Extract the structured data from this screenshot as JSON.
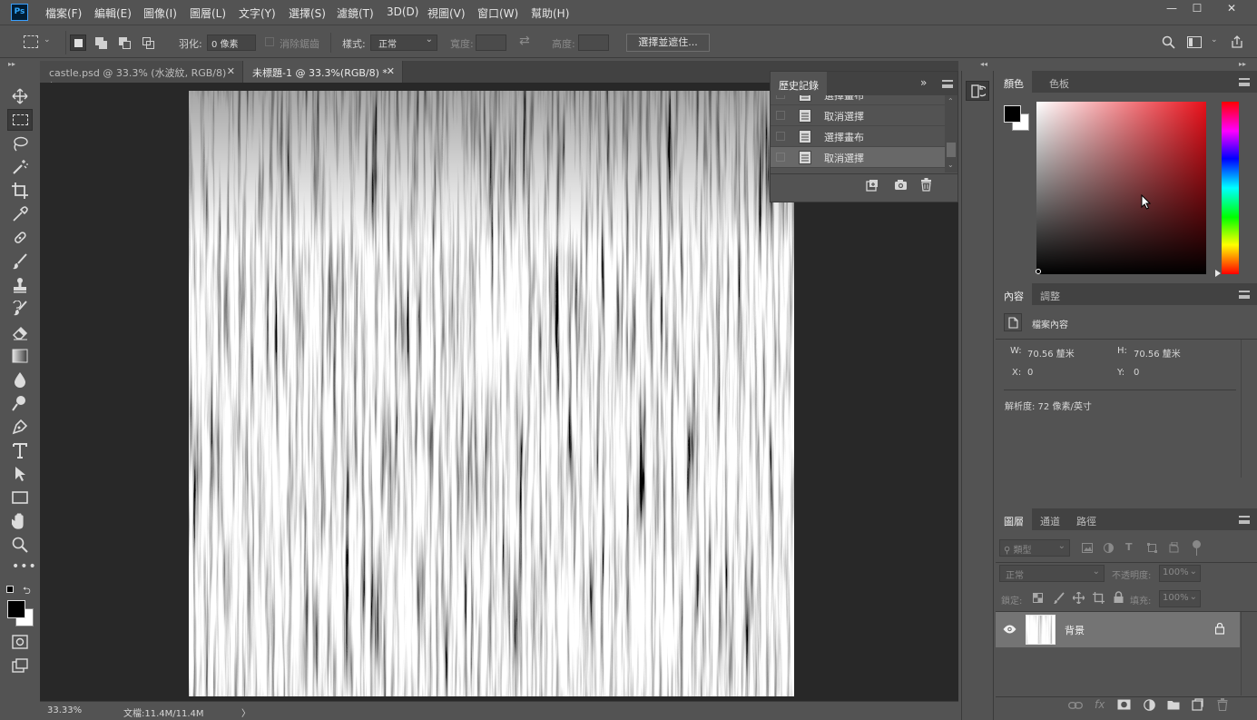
{
  "app": {
    "logo_text": "Ps"
  },
  "menu": [
    "檔案(F)",
    "編輯(E)",
    "圖像(I)",
    "圖層(L)",
    "文字(Y)",
    "選擇(S)",
    "濾鏡(T)",
    "3D(D)",
    "視圖(V)",
    "窗口(W)",
    "幫助(H)"
  ],
  "window_controls": {
    "minimize": "—",
    "maximize": "☐",
    "close": "✕"
  },
  "options": {
    "feather_label": "羽化:",
    "feather_value": "0 像素",
    "antialias_label": "消除鋸齒",
    "style_label": "樣式:",
    "style_value": "正常",
    "width_label": "寬度:",
    "height_label": "高度:",
    "select_mask_button": "選擇並遮住..."
  },
  "tabs": [
    {
      "label": "castle.psd @ 33.3% (水波紋, RGB/8) *",
      "close": "✕"
    },
    {
      "label": "未標題-1 @ 33.3%(RGB/8) *",
      "close": "✕"
    }
  ],
  "status": {
    "zoom": "33.33%",
    "doc_info": "文檔:11.4M/11.4M",
    "arrow": "〉"
  },
  "history": {
    "title": "歷史記錄",
    "items": [
      "選擇畫布",
      "取消選擇",
      "選擇畫布",
      "取消選擇"
    ],
    "selected_index": 3
  },
  "color_panel": {
    "tabs": [
      "顏色",
      "色板"
    ],
    "foreground": "#000000",
    "background": "#ffffff",
    "hue_color": "#e8101a"
  },
  "properties_panel": {
    "tabs": [
      "內容",
      "調整"
    ],
    "type_label": "檔案內容",
    "w_label": "W:",
    "w_value": "70.56 釐米",
    "h_label": "H:",
    "h_value": "70.56 釐米",
    "x_label": "X:",
    "x_value": "0",
    "y_label": "Y:",
    "y_value": "0",
    "resolution": "解析度: 72 像素/英寸"
  },
  "layers_panel": {
    "tabs": [
      "圖層",
      "通道",
      "路徑"
    ],
    "filter_label": "類型",
    "blend_mode": "正常",
    "opacity_label": "不透明度:",
    "opacity_value": "100%",
    "lock_label": "鎖定:",
    "fill_label": "填充:",
    "fill_value": "100%",
    "layers": [
      {
        "name": "背景",
        "visible": true,
        "locked": true
      }
    ]
  }
}
